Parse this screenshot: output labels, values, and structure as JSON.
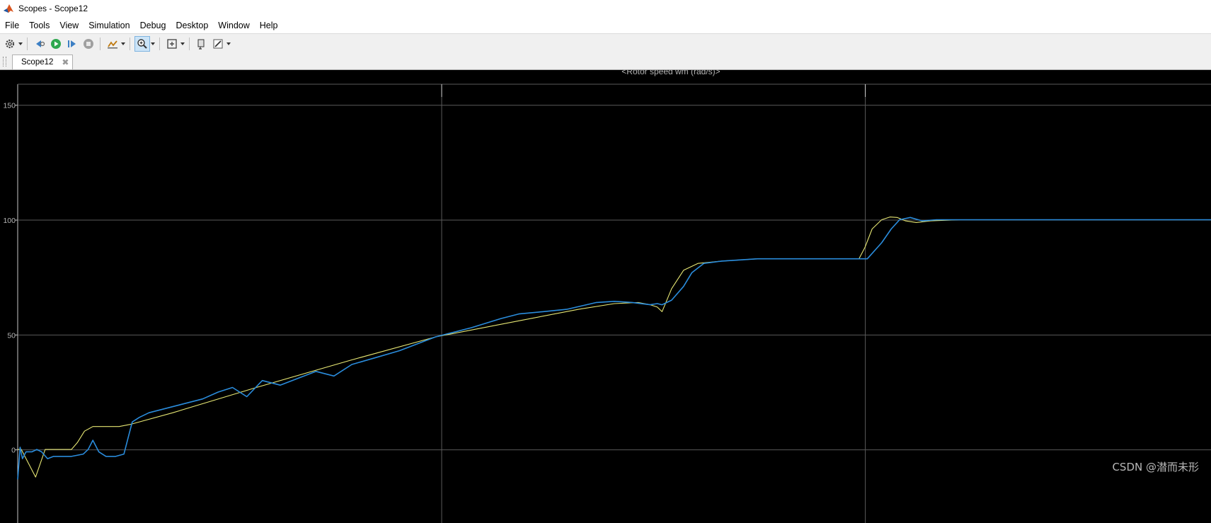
{
  "window": {
    "title": "Scopes - Scope12"
  },
  "menu": {
    "items": [
      "File",
      "Tools",
      "View",
      "Simulation",
      "Debug",
      "Desktop",
      "Window",
      "Help"
    ]
  },
  "toolbar": {
    "buttons": [
      "settings-gear-icon",
      "step-back-icon",
      "run-icon",
      "step-forward-icon",
      "stop-icon",
      "highlight-signal-icon",
      "zoom-in-icon",
      "fit-to-view-icon",
      "triggers-icon",
      "edit-style-icon"
    ],
    "active": "zoom-in-icon"
  },
  "tabs": [
    {
      "label": "Scope12"
    }
  ],
  "watermark": "CSDN @潜而未形",
  "colors": {
    "plot_bg": "#000000",
    "grid": "#5a5a5a",
    "axis_text": "#b4b4b4",
    "series_reference": "#e6e673",
    "series_measured": "#2a8cdc"
  },
  "chart_data": {
    "type": "line",
    "title": "<Rotor speed wm (rad/s)>",
    "xlabel": "",
    "ylabel": "",
    "ylim": [
      -32,
      159
    ],
    "xlim": [
      0,
      100
    ],
    "grid": true,
    "yticks": [
      0,
      50,
      100,
      150
    ],
    "xgrid_positions": [
      35.5,
      71
    ],
    "series": [
      {
        "name": "",
        "color": "#e6e673",
        "x": [
          0,
          0.3,
          0.9,
          1.5,
          2.3,
          4.5,
          5.0,
          5.6,
          6.3,
          7.0,
          8.5,
          9.5,
          13,
          20,
          28,
          35,
          42,
          47,
          50,
          52,
          53,
          53.6,
          54,
          54.8,
          55.8,
          57,
          59,
          62,
          66,
          69,
          70.5,
          71.0,
          71.6,
          72.4,
          73.1,
          73.7,
          74.4,
          75.3,
          76.5,
          79,
          85,
          92,
          100
        ],
        "y": [
          0,
          0,
          -6,
          -12,
          0,
          0,
          3,
          8,
          10,
          10,
          10,
          11,
          16,
          27,
          39,
          49,
          56,
          61,
          63.5,
          64,
          63,
          62,
          60,
          70,
          78,
          81,
          82,
          83,
          83,
          83,
          83,
          88,
          96,
          100,
          101.2,
          101,
          99.5,
          98.8,
          99.5,
          100,
          100,
          100,
          100
        ]
      },
      {
        "name": "",
        "color": "#2a8cdc",
        "x": [
          0,
          0.2,
          0.4,
          0.7,
          1.2,
          1.6,
          2.0,
          2.5,
          3.0,
          3.5,
          4.5,
          5.5,
          5.9,
          6.3,
          6.8,
          7.4,
          8.2,
          8.9,
          9.3,
          9.6,
          10.2,
          11,
          12.5,
          14,
          15.5,
          16.8,
          18,
          19.2,
          20.5,
          22,
          23.5,
          25,
          26.5,
          28,
          30,
          32,
          35,
          38,
          40.5,
          42,
          44,
          46,
          48.5,
          50,
          51.5,
          53,
          53.6,
          54,
          54.8,
          55.8,
          56.5,
          57.5,
          59,
          62,
          66,
          69,
          70.5,
          71.2,
          72.4,
          73.2,
          73.9,
          74.8,
          75.8,
          77,
          79,
          85,
          92,
          100
        ],
        "y": [
          -13,
          1,
          -4,
          -1,
          -1,
          0,
          -1,
          -4,
          -3,
          -3,
          -3,
          -2,
          0,
          4,
          -1,
          -3,
          -3,
          -2,
          6,
          12,
          14,
          16,
          18,
          20,
          22,
          25,
          27,
          23,
          30,
          28,
          31,
          34,
          32,
          37,
          40,
          43,
          49,
          53,
          57,
          59,
          60,
          61,
          64,
          64.5,
          64,
          63,
          63.5,
          63,
          65,
          71,
          77,
          81,
          82,
          83,
          83,
          83,
          83,
          83,
          90,
          96,
          100,
          101,
          99.5,
          100,
          100,
          100,
          100,
          100
        ]
      }
    ]
  }
}
